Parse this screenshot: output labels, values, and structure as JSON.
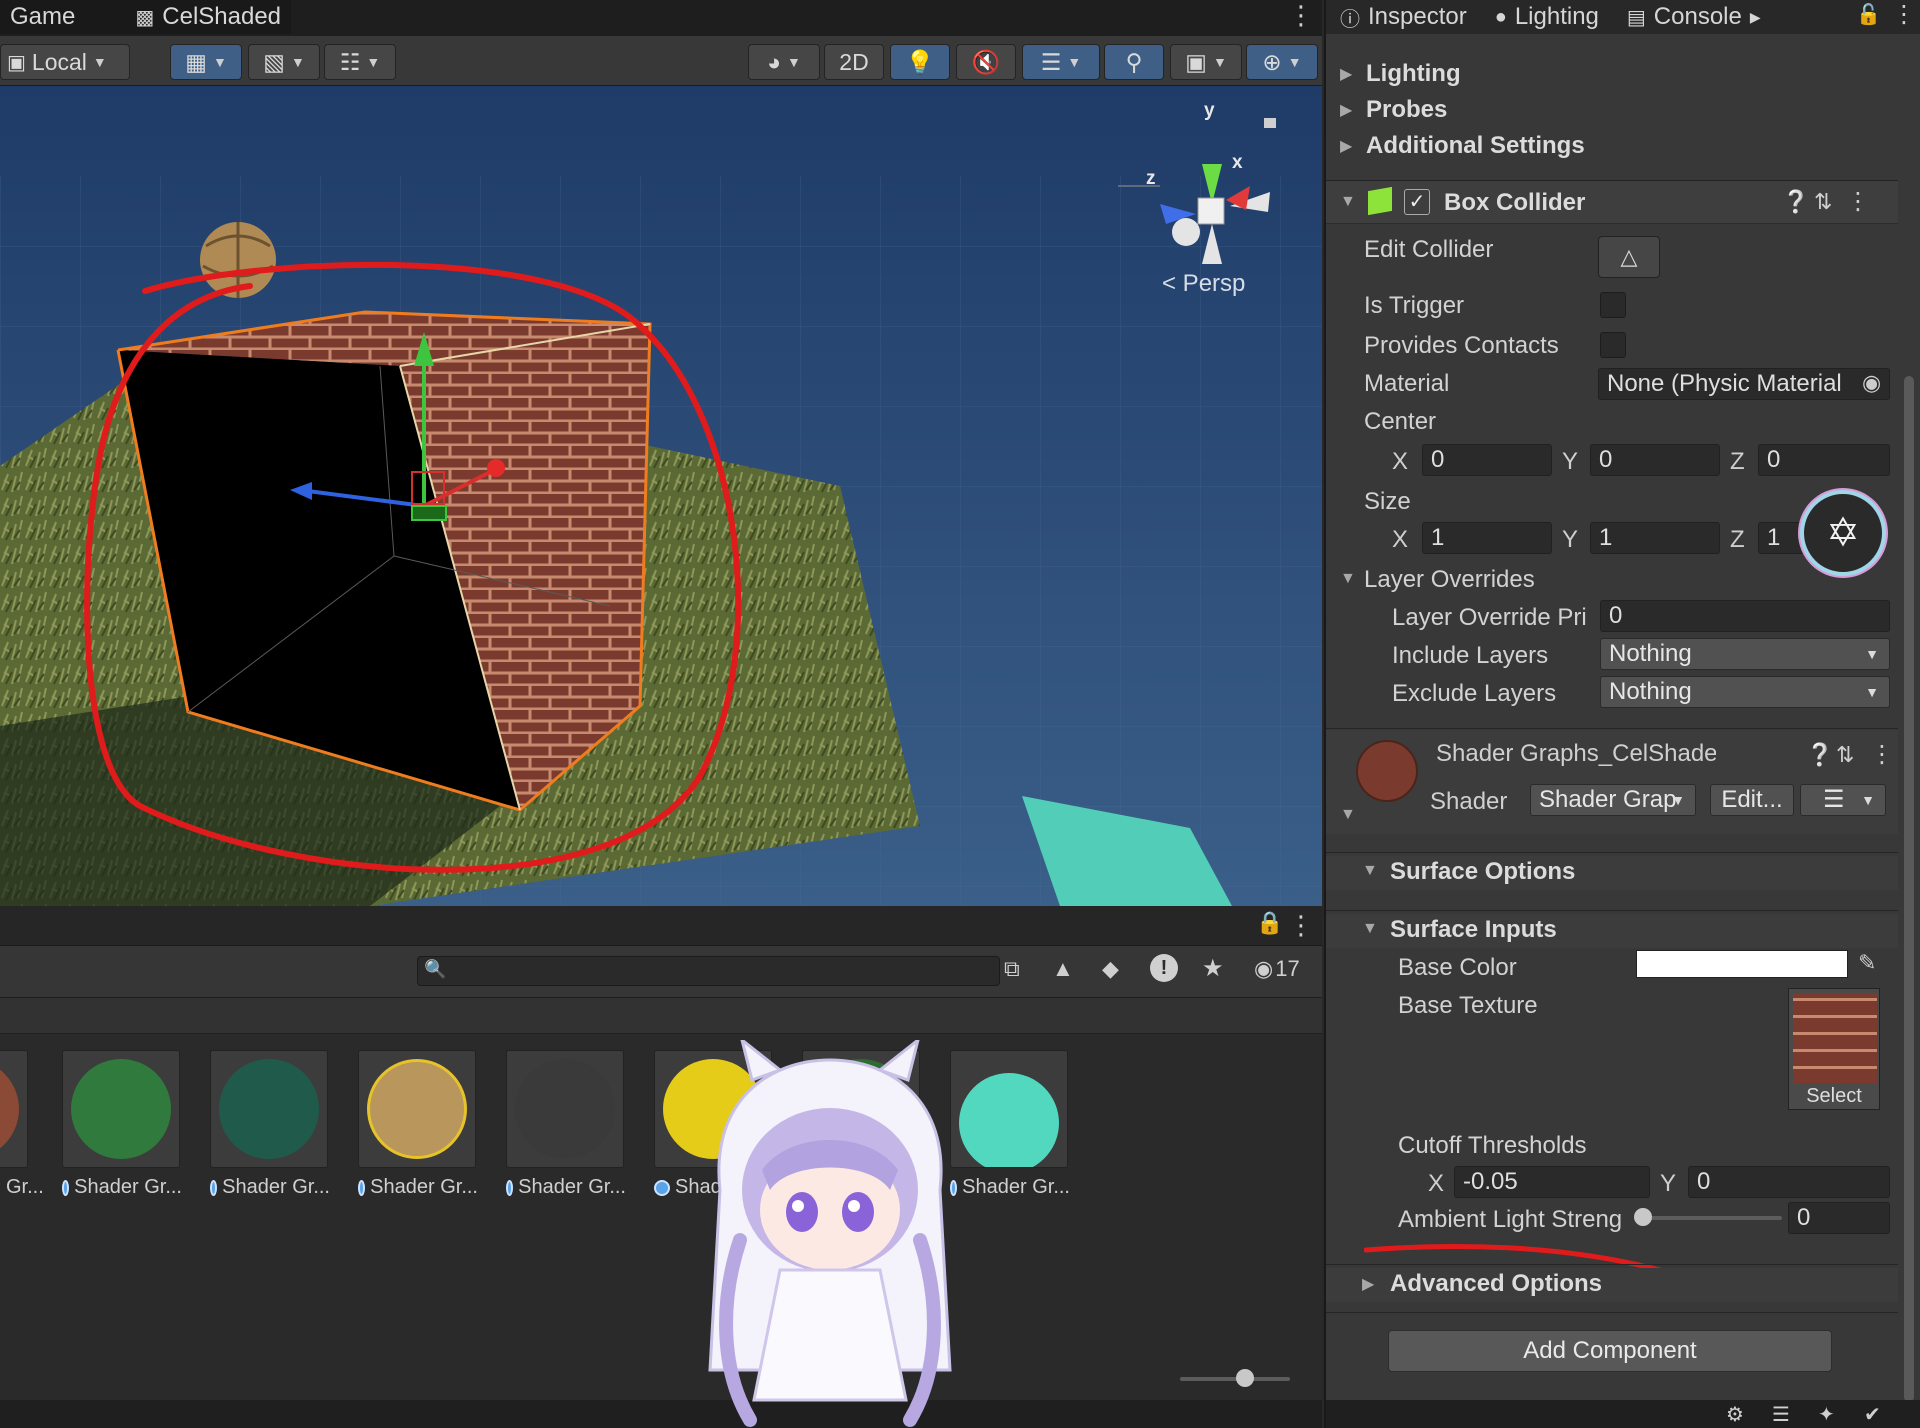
{
  "left_tabs": {
    "game": "Game",
    "scene": "CelShaded"
  },
  "scene_toolbar": {
    "pivot_label": "Local",
    "two_d_label": "2D"
  },
  "viewport": {
    "persp_label": "< Persp",
    "gizmo_y": "y",
    "gizmo_x": "x",
    "gizmo_z": "z"
  },
  "project": {
    "search_placeholder": "",
    "hidden_count": "17"
  },
  "assets": [
    {
      "label": "Gr...",
      "color": "#8b4a35"
    },
    {
      "label": "Shader Gr...",
      "color": "#2f7a3c"
    },
    {
      "label": "Shader Gr...",
      "color": "#1f5a4a"
    },
    {
      "label": "Shader Gr...",
      "color": "#b8965c"
    },
    {
      "label": "Shader Gr...",
      "color": "#3a3a3a"
    },
    {
      "label": "Shad",
      "color": "#e4cc18"
    },
    {
      "label": "",
      "color": "#2f6b32"
    },
    {
      "label": "Shader Gr...",
      "color": "#52d8bf"
    }
  ],
  "inspector_tabs": {
    "inspector": "Inspector",
    "lighting": "Lighting",
    "console": "Console"
  },
  "inspector": {
    "lighting": "Lighting",
    "probes": "Probes",
    "additional_settings": "Additional Settings",
    "box_collider": {
      "title": "Box Collider",
      "edit_collider": "Edit Collider",
      "is_trigger": "Is Trigger",
      "provides_contacts": "Provides Contacts",
      "material_label": "Material",
      "material_value": "None (Physic Material",
      "center_label": "Center",
      "center": {
        "x": "0",
        "y": "0",
        "z": "0"
      },
      "size_label": "Size",
      "size": {
        "x": "1",
        "y": "1",
        "z": "1"
      },
      "axis_x": "X",
      "axis_y": "Y",
      "axis_z": "Z",
      "layer_overrides": "Layer Overrides",
      "layer_override_priority_label": "Layer Override Pri",
      "layer_override_priority_value": "0",
      "include_layers_label": "Include Layers",
      "include_layers_value": "Nothing",
      "exclude_layers_label": "Exclude Layers",
      "exclude_layers_value": "Nothing"
    },
    "material": {
      "title": "Shader Graphs_CelShaded (M",
      "shader_label": "Shader",
      "shader_value": "Shader Grap",
      "edit_label": "Edit...",
      "surface_options": "Surface Options",
      "surface_inputs": "Surface Inputs",
      "base_color_label": "Base Color",
      "base_color_value": "#ffffff",
      "base_texture_label": "Base Texture",
      "select_label": "Select",
      "cutoff_label": "Cutoff Thresholds",
      "cutoff_x": "-0.05",
      "cutoff_y": "0",
      "ambient_label": "Ambient Light Streng",
      "ambient_value": "0",
      "advanced_options": "Advanced Options"
    },
    "add_component": "Add Component"
  },
  "colors": {
    "accent_blue": "#3f5f86",
    "annotation_red": "#e01b1b"
  }
}
